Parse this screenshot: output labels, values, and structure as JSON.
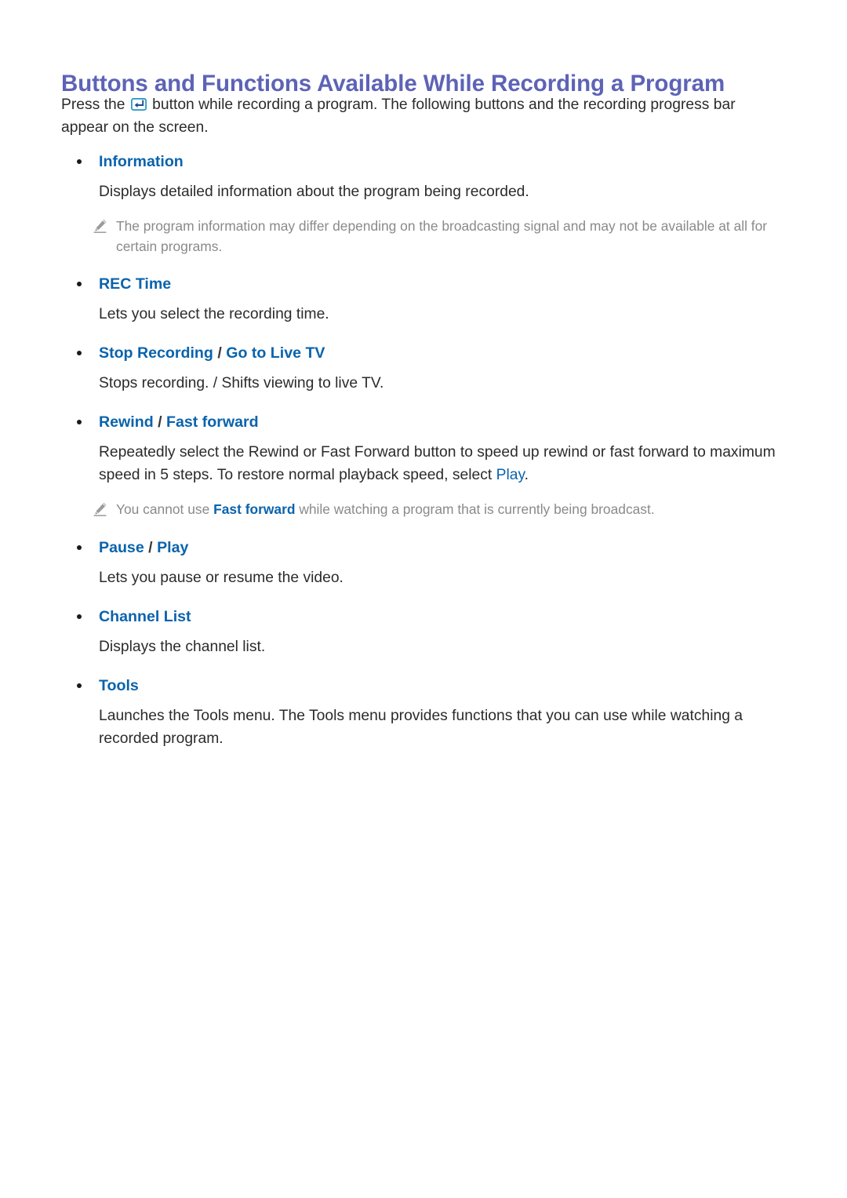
{
  "page": {
    "title": "Buttons and Functions Available While Recording a Program",
    "title_color": "#5d63b6",
    "accent_color": "#0a63ac",
    "body_color": "#2b2b2b",
    "note_color": "#8a8a8a",
    "background": "#ffffff"
  },
  "intro": {
    "before_icon": "Press the ",
    "icon": "enter-key-icon",
    "after_icon": " button while recording a program. The following buttons and the recording progress bar appear on the screen."
  },
  "sections": [
    {
      "title": "Information",
      "title_parts": [
        {
          "text": "Information",
          "style": "accent"
        }
      ],
      "description": "Displays detailed information about the program being recorded.",
      "notes": [
        {
          "icon": "pencil-note-icon",
          "parts": [
            {
              "text": "The program information may differ depending on the broadcasting signal and may not be available at all for certain programs.",
              "style": "plain"
            }
          ]
        }
      ]
    },
    {
      "title": "REC Time",
      "title_parts": [
        {
          "text": "REC Time",
          "style": "accent"
        }
      ],
      "description": "Lets you select the recording time.",
      "notes": []
    },
    {
      "title": "Stop Recording / Go to Live TV",
      "title_parts": [
        {
          "text": "Stop Recording",
          "style": "accent"
        },
        {
          "text": " / ",
          "style": "separator"
        },
        {
          "text": "Go to Live TV",
          "style": "accent"
        }
      ],
      "description": "Stops recording. / Shifts viewing to live TV.",
      "notes": []
    },
    {
      "title": "Rewind / Fast forward",
      "title_parts": [
        {
          "text": "Rewind",
          "style": "accent"
        },
        {
          "text": " / ",
          "style": "separator"
        },
        {
          "text": "Fast forward",
          "style": "accent"
        }
      ],
      "description_parts": [
        {
          "text": "Repeatedly select the Rewind or Fast Forward button to speed up rewind or fast forward to maximum speed in 5 steps. To restore normal playback speed, select ",
          "style": "plain"
        },
        {
          "text": "Play",
          "style": "accent"
        },
        {
          "text": ".",
          "style": "plain"
        }
      ],
      "notes": [
        {
          "icon": "pencil-note-icon",
          "parts": [
            {
              "text": "You cannot use ",
              "style": "plain"
            },
            {
              "text": "Fast forward",
              "style": "accent"
            },
            {
              "text": " while watching a program that is currently being broadcast.",
              "style": "plain"
            }
          ]
        }
      ]
    },
    {
      "title": "Pause / Play",
      "title_parts": [
        {
          "text": "Pause",
          "style": "accent"
        },
        {
          "text": " / ",
          "style": "separator"
        },
        {
          "text": "Play",
          "style": "accent"
        }
      ],
      "description": "Lets you pause or resume the video.",
      "notes": []
    },
    {
      "title": "Channel List",
      "title_parts": [
        {
          "text": "Channel List",
          "style": "accent"
        }
      ],
      "description": "Displays the channel list.",
      "notes": []
    },
    {
      "title": "Tools",
      "title_parts": [
        {
          "text": "Tools",
          "style": "accent"
        }
      ],
      "description": "Launches the Tools menu. The Tools menu provides functions that you can use while watching a recorded program.",
      "notes": []
    }
  ]
}
